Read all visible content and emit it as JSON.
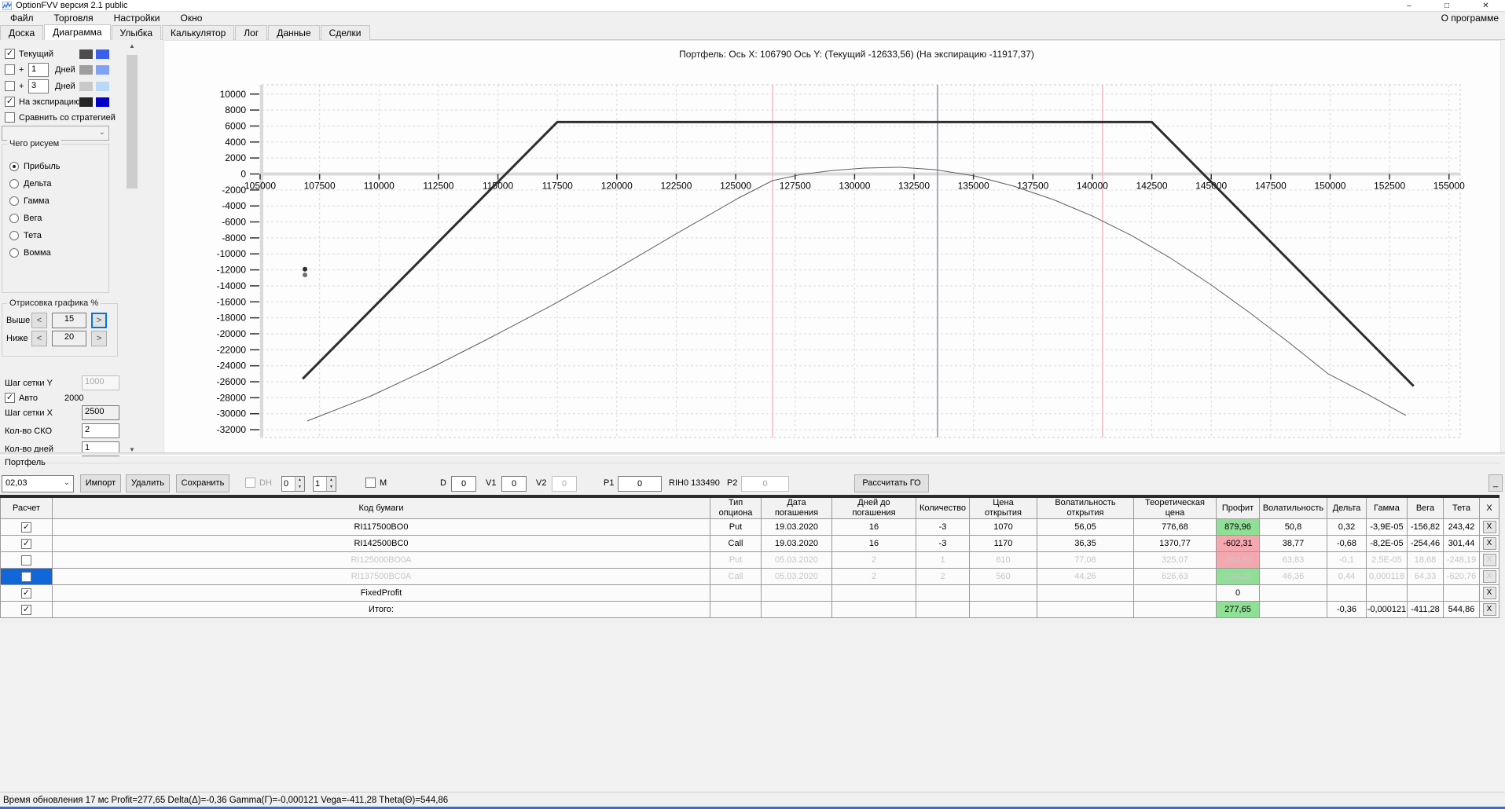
{
  "window": {
    "title": "OptionFVV версия 2.1 public",
    "minimize": "–",
    "maximize": "□",
    "close": "✕"
  },
  "menu": {
    "items": [
      "Файл",
      "Торговля",
      "Настройки",
      "Окно"
    ],
    "about": "О программе"
  },
  "tabs": {
    "items": [
      "Доска",
      "Диаграмма",
      "Улыбка",
      "Калькулятор",
      "Лог",
      "Данные",
      "Сделки"
    ],
    "active": "Диаграмма"
  },
  "sidebar": {
    "series": [
      {
        "label": "Текущий",
        "checked": true,
        "days": null,
        "colors": [
          "#4d4d4d",
          "#3a5fe8"
        ]
      },
      {
        "label": "Дней",
        "checked": false,
        "days": "1",
        "colors": [
          "#9e9e9e",
          "#7fa3f2"
        ]
      },
      {
        "label": "Дней",
        "checked": false,
        "days": "3",
        "colors": [
          "#c9c9c9",
          "#b9d9f7"
        ]
      },
      {
        "label": "На экспирацию",
        "checked": true,
        "days": null,
        "colors": [
          "#262626",
          "#0000c8"
        ]
      },
      {
        "label": "Сравнить со стратегией",
        "checked": false,
        "days": null,
        "colors": []
      }
    ],
    "plus_sign": "+",
    "what_group": {
      "title": "Чего рисуем",
      "options": [
        "Прибыль",
        "Дельта",
        "Гамма",
        "Вега",
        "Тета",
        "Вомма"
      ],
      "selected": "Прибыль"
    },
    "draw_group": {
      "title": "Отрисовка графика %",
      "rows": [
        {
          "label": "Выше",
          "value": "15"
        },
        {
          "label": "Ниже",
          "value": "20"
        }
      ],
      "dec": "<",
      "inc": ">"
    },
    "grid_y_label": "Шаг сетки Y",
    "grid_y_value": "1000",
    "auto_label": "Авто",
    "auto_checked": true,
    "auto_value": "2000",
    "grid_x_label": "Шаг сетки X",
    "grid_x_value": "2500",
    "sko_label": "Кол-во СКО",
    "sko_value": "2",
    "days_label": "Кол-во дней",
    "days_value": "1"
  },
  "chart_data": {
    "type": "line",
    "title": "Портфель: Ось X: 106790 Ось Y:   (Текущий -12633,56)   (На экспирацию -11917,37)",
    "xlim": [
      104850,
      156500
    ],
    "ylim": [
      -33000,
      11100
    ],
    "x_ticks_min": 105000,
    "x_ticks_max": 155000,
    "x_ticks_step": 2500,
    "y_ticks_min": -32000,
    "y_ticks_max": 10000,
    "y_ticks_step": 2000,
    "grid": true,
    "current_price_line": 133490,
    "sigma_lines": [
      126550,
      140430
    ],
    "cursor_dots": [
      {
        "x": 106885,
        "y": -11917,
        "color": "#2e2e2e"
      },
      {
        "x": 106885,
        "y": -12633,
        "color": "#6f6f6f"
      }
    ],
    "series": [
      {
        "name": "На экспирацию",
        "color": "#2e2e2e",
        "width": 3,
        "points": [
          [
            106790,
            -25630
          ],
          [
            117500,
            6500
          ],
          [
            142500,
            6500
          ],
          [
            153513,
            -26540
          ]
        ]
      },
      {
        "name": "Текущий",
        "color": "#5f5f5f",
        "width": 1,
        "points": [
          [
            106983,
            -30909
          ],
          [
            109594,
            -27862
          ],
          [
            112073,
            -24423
          ],
          [
            114552,
            -20688
          ],
          [
            117196,
            -16560
          ],
          [
            119840,
            -12137
          ],
          [
            122483,
            -7518
          ],
          [
            125127,
            -2997
          ],
          [
            126548,
            -835
          ],
          [
            127771,
            -49
          ],
          [
            129093,
            442
          ],
          [
            130415,
            737
          ],
          [
            131902,
            835
          ],
          [
            133390,
            540
          ],
          [
            135043,
            -246
          ],
          [
            136695,
            -1523
          ],
          [
            138348,
            -3194
          ],
          [
            140001,
            -5258
          ],
          [
            141653,
            -7714
          ],
          [
            143306,
            -10564
          ],
          [
            144959,
            -13807
          ],
          [
            146611,
            -17345
          ],
          [
            148264,
            -21080
          ],
          [
            149917,
            -25011
          ],
          [
            151569,
            -27567
          ],
          [
            153188,
            -30220
          ]
        ]
      }
    ]
  },
  "portfolio": {
    "group_label": "Портфель",
    "combo_value": "02,03",
    "import_btn": "Импорт",
    "delete_btn": "Удалить",
    "save_btn": "Сохранить",
    "dh_label": "DH",
    "spin1": "0",
    "spin2": "1",
    "m_label": "M",
    "d_label": "D",
    "d_value": "0",
    "v1_label": "V1",
    "v1_value": "0",
    "v2_label": "V2",
    "v2_value": "0",
    "p1_label": "P1",
    "p1_value": "0",
    "ticker": "RIH0 133490",
    "p2_label": "P2",
    "p2_value": "0",
    "calc_btn": "Рассчитать ГО",
    "corner_btn": "_"
  },
  "table": {
    "columns": [
      "Расчет",
      "Код бумаги",
      "Тип\nопциона",
      "Дата\nпогашения",
      "Дней до\nпогашения",
      "Количество",
      "Цена\nоткрытия",
      "Волатильность\nоткрытия",
      "Теоретическая\nцена",
      "Профит",
      "Волатильность",
      "Дельта",
      "Гамма",
      "Вега",
      "Тета",
      "X"
    ],
    "x_button": "X",
    "rows": [
      {
        "checked": true,
        "selected": false,
        "disabled": false,
        "code": "RI117500BO0",
        "type": "Put",
        "date": "19.03.2020",
        "days": "16",
        "qty": "-3",
        "price": "1070",
        "vol_open": "56,05",
        "theor": "776,68",
        "profit": "879,96",
        "profit_bg": "green",
        "vol": "50,8",
        "delta": "0,32",
        "gamma": "-3,9E-05",
        "vega": "-156,82",
        "theta": "243,42"
      },
      {
        "checked": true,
        "selected": false,
        "disabled": false,
        "code": "RI142500BC0",
        "type": "Call",
        "date": "19.03.2020",
        "days": "16",
        "qty": "-3",
        "price": "1170",
        "vol_open": "36,35",
        "theor": "1370,77",
        "profit": "-602,31",
        "profit_bg": "red",
        "vol": "38,77",
        "delta": "-0,68",
        "gamma": "-8,2E-05",
        "vega": "-254,46",
        "theta": "301,44"
      },
      {
        "checked": false,
        "selected": false,
        "disabled": true,
        "code": "RI125000BO0A",
        "type": "Put",
        "date": "05.03.2020",
        "days": "2",
        "qty": "1",
        "price": "610",
        "vol_open": "77,08",
        "theor": "325,07",
        "profit": "-284,93",
        "profit_bg": "red",
        "vol": "63,83",
        "delta": "-0,1",
        "gamma": "2,5E-05",
        "vega": "18,68",
        "theta": "-248,19"
      },
      {
        "checked": false,
        "selected": true,
        "disabled": true,
        "code": "RI137500BC0A",
        "type": "Call",
        "date": "05.03.2020",
        "days": "2",
        "qty": "2",
        "price": "560",
        "vol_open": "44,26",
        "theor": "626,63",
        "profit": "139,26",
        "profit_bg": "green",
        "vol": "46,36",
        "delta": "0,44",
        "gamma": "0,000118",
        "vega": "64,33",
        "theta": "-620,76"
      },
      {
        "checked": true,
        "selected": false,
        "disabled": false,
        "code": "FixedProfit",
        "type": "",
        "date": "",
        "days": "",
        "qty": "",
        "price": "",
        "vol_open": "",
        "theor": "",
        "profit": "0",
        "profit_bg": "none",
        "vol": "",
        "delta": "",
        "gamma": "",
        "vega": "",
        "theta": ""
      },
      {
        "checked": true,
        "selected": false,
        "disabled": false,
        "code": "Итого:",
        "type": "",
        "date": "",
        "days": "",
        "qty": "",
        "price": "",
        "vol_open": "",
        "theor": "",
        "profit": "277,65",
        "profit_bg": "green",
        "vol": "",
        "delta": "-0,36",
        "gamma": "-0,000121",
        "vega": "-411,28",
        "theta": "544,86"
      }
    ]
  },
  "status": "Время обновления 17 мс   Profit=277,65 Delta(Δ)=-0,36 Gamma(Г)=-0,000121 Vega=-411,28 Theta(Θ)=544,86"
}
